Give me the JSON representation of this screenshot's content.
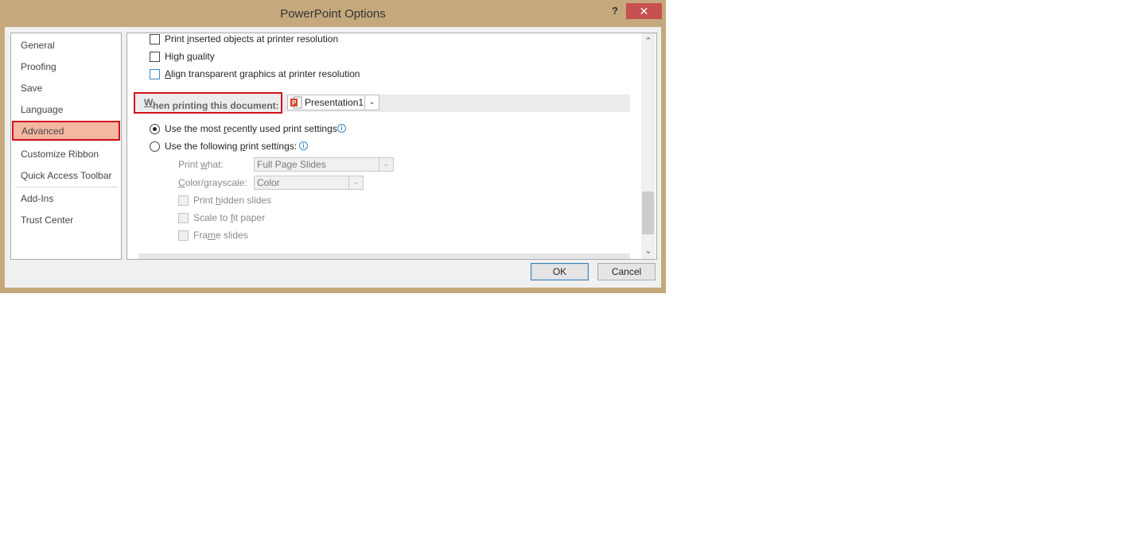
{
  "window": {
    "title": "PowerPoint Options",
    "help_label": "?",
    "close_label": "✕",
    "accent_color": "#c5a97d",
    "close_color": "#c75050"
  },
  "sidebar": {
    "items": [
      {
        "label": "General"
      },
      {
        "label": "Proofing"
      },
      {
        "label": "Save"
      },
      {
        "label": "Language"
      },
      {
        "label": "Advanced",
        "selected": true
      },
      {
        "label": "Customize Ribbon"
      },
      {
        "label": "Quick Access Toolbar"
      },
      {
        "label": "Add-Ins"
      },
      {
        "label": "Trust Center"
      }
    ]
  },
  "print_options": {
    "print_inserted_objects": {
      "prefix": "Print ",
      "u": "i",
      "suffix": "nserted objects at printer resolution",
      "checked": false
    },
    "high_quality": {
      "prefix": "High ",
      "u": "q",
      "suffix": "uality",
      "checked": false
    },
    "align_transparent": {
      "prefix": "",
      "u": "A",
      "suffix": "lign transparent graphics at printer resolution",
      "checked": false
    }
  },
  "section": {
    "label_u": "W",
    "label_rest": "hen printing this document:",
    "document_combo": {
      "value": "Presentation1",
      "icon": "powerpoint-icon"
    }
  },
  "print_settings": {
    "use_recent": {
      "prefix": "Use the most ",
      "u": "r",
      "suffix": "ecently used print settings",
      "selected": true
    },
    "use_following": {
      "prefix": "Use the following ",
      "u": "p",
      "suffix": "rint settings:",
      "selected": false
    },
    "print_what": {
      "prefix": "Print ",
      "u": "w",
      "suffix": "hat:",
      "value": "Full Page Slides"
    },
    "color_grayscale": {
      "prefix": "",
      "u": "C",
      "suffix": "olor/grayscale:",
      "value": "Color"
    },
    "print_hidden": {
      "prefix": "Print ",
      "u": "h",
      "suffix": "idden slides",
      "checked": false
    },
    "scale_to_fit": {
      "prefix": "Scale to ",
      "u": "f",
      "suffix": "it paper",
      "checked": false
    },
    "frame_slides": {
      "prefix": "Fra",
      "u": "m",
      "suffix": "e slides",
      "checked": false
    }
  },
  "buttons": {
    "ok": "OK",
    "cancel": "Cancel"
  }
}
